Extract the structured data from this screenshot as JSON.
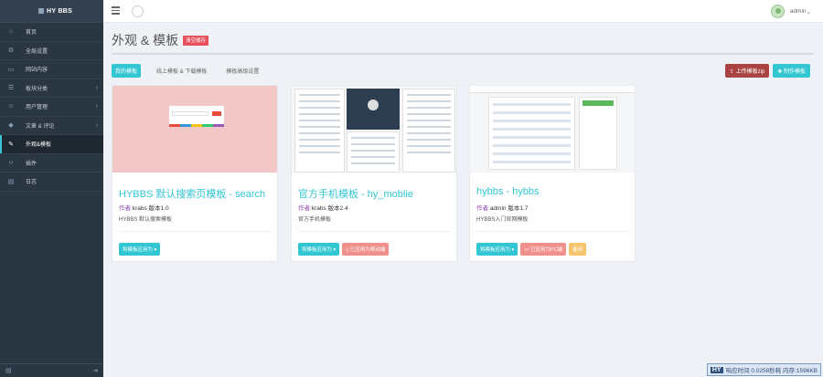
{
  "brand": {
    "name": "HY BBS"
  },
  "sidebar": {
    "items": [
      {
        "label": "首页",
        "icon": "home-icon",
        "glyph": "⌂",
        "arrow": "",
        "active": false
      },
      {
        "label": "全局设置",
        "icon": "gear-icon",
        "glyph": "⚙",
        "arrow": "",
        "active": false
      },
      {
        "label": "网站内容",
        "icon": "monitor-icon",
        "glyph": "▭",
        "arrow": "",
        "active": false
      },
      {
        "label": "板块分类",
        "icon": "list-icon",
        "glyph": "☰",
        "arrow": "›",
        "active": false
      },
      {
        "label": "用户管理",
        "icon": "users-icon",
        "glyph": "☺",
        "arrow": "›",
        "active": false
      },
      {
        "label": "文章 & 评论",
        "icon": "tag-icon",
        "glyph": "◆",
        "arrow": "›",
        "active": false
      },
      {
        "label": "外观&模板",
        "icon": "brush-icon",
        "glyph": "✎",
        "arrow": "",
        "active": true
      },
      {
        "label": "插件",
        "icon": "code-icon",
        "glyph": "‹›",
        "arrow": "",
        "active": false
      },
      {
        "label": "日志",
        "icon": "log-icon",
        "glyph": "▤",
        "arrow": "",
        "active": false
      }
    ]
  },
  "topbar": {
    "user": "admin",
    "user_caret": "⌄"
  },
  "page": {
    "title": "外观 & 模板",
    "badge": "清空缓存"
  },
  "tabs": [
    {
      "label": "我的模板",
      "active": true
    },
    {
      "label": "线上模板 & 下载模板",
      "active": false
    },
    {
      "label": "模板高级设置",
      "active": false
    }
  ],
  "actions": {
    "upload": "⇪ 上传模板zip",
    "create": "✚ 制作模板"
  },
  "cards": [
    {
      "title": "HYBBS 默认搜索页模板 - search",
      "author_label": "作者:",
      "author": "krabs",
      "version_label": "版本",
      "version": "1.0",
      "desc": "HYBBS 默认搜索模板",
      "buttons": [
        "将模板应用为 ▾"
      ]
    },
    {
      "title": "官方手机模板 - hy_moblie",
      "author_label": "作者:",
      "author": "krabs",
      "version_label": "版本",
      "version": "2.4",
      "desc": "官方手机模板",
      "buttons": [
        "将模板应用为 ▾",
        "▯ 已应用为移动端"
      ]
    },
    {
      "title": "hybbs - hybbs",
      "author_label": "作者:",
      "author": "admin",
      "version_label": "版本",
      "version": "1.7",
      "desc": "HYBBS入门官网模板",
      "buttons": [
        "将模板应用为 ▾",
        "▭ 已应用为PC端",
        "备用"
      ]
    }
  ],
  "sidebar_bottom": {
    "left": "▤",
    "right": "⇥"
  },
  "footer": {
    "logo": "HY",
    "stats": "响应时间 0.0258秒耗 内存:1596KB"
  },
  "colors": {
    "accent": "#32c5d2",
    "sidebar": "#2b3643",
    "danger": "#e7505a"
  }
}
